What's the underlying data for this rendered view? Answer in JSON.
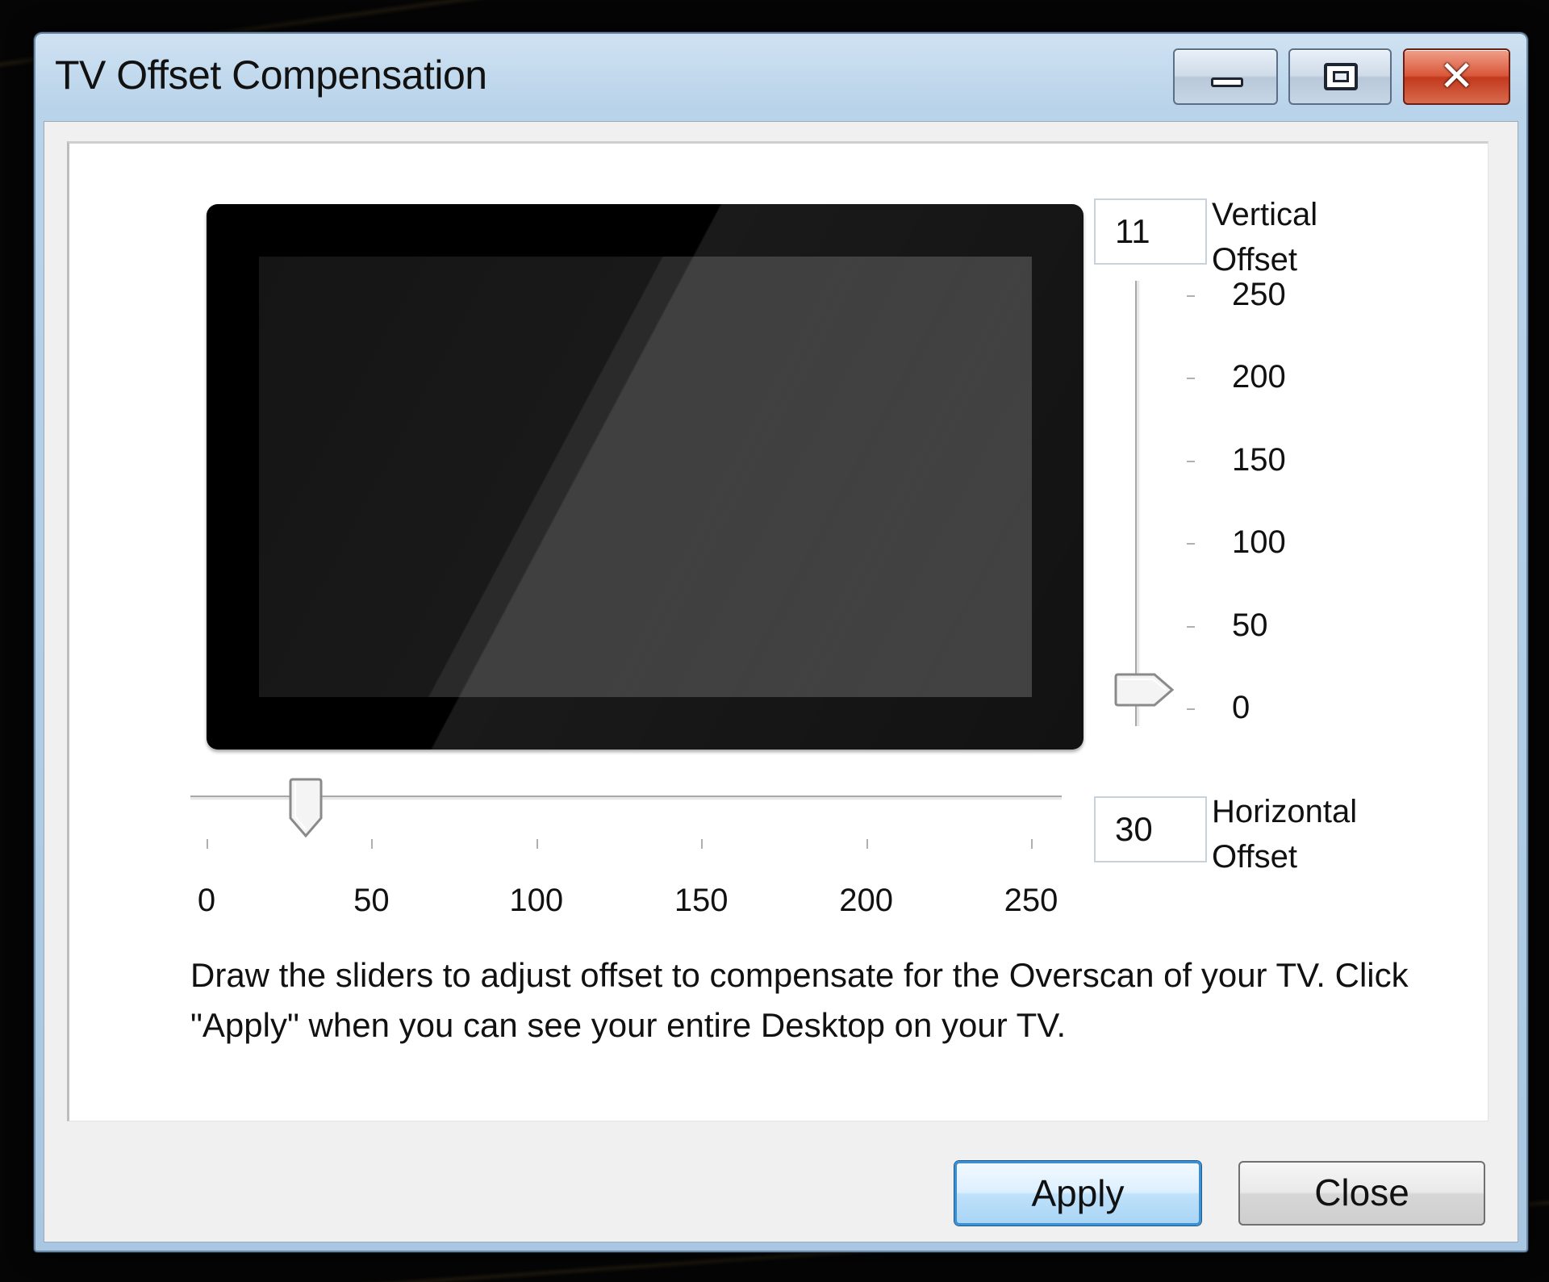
{
  "window": {
    "title": "TV Offset Compensation"
  },
  "icons": {
    "minimize": "minimize-icon",
    "maximize": "maximize-icon",
    "close": "close-icon"
  },
  "vertical": {
    "value": "11",
    "caption_line1": "Vertical",
    "caption_line2": "Offset",
    "ticks": [
      "250",
      "200",
      "150",
      "100",
      "50",
      "0"
    ],
    "min": 0,
    "max": 250,
    "thumb_value": 11
  },
  "horizontal": {
    "value": "30",
    "caption_line1": "Horizontal",
    "caption_line2": "Offset",
    "ticks": [
      "0",
      "50",
      "100",
      "150",
      "200",
      "250"
    ],
    "min": 0,
    "max": 250,
    "thumb_value": 30
  },
  "instructions": "Draw the sliders to adjust offset to compensate for the Overscan of your TV. Click \"Apply\" when you can see your entire Desktop on your TV.",
  "buttons": {
    "apply": "Apply",
    "close": "Close"
  }
}
